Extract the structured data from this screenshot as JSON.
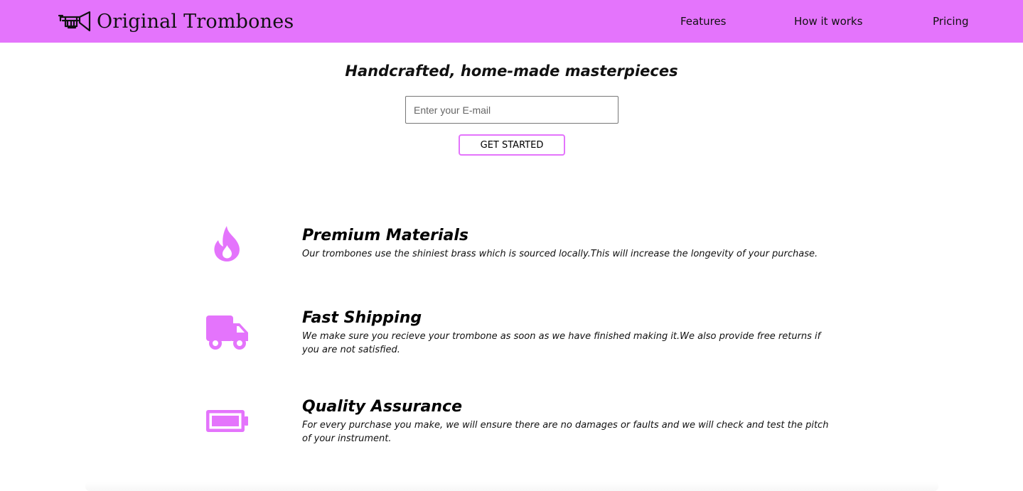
{
  "header": {
    "brand": "Original Trombones",
    "logo_icon": "trombone-icon",
    "nav": [
      {
        "label": "Features"
      },
      {
        "label": "How it works"
      },
      {
        "label": "Pricing"
      }
    ]
  },
  "hero": {
    "title": "Handcrafted, home-made masterpieces",
    "email_placeholder": "Enter your E-mail",
    "email_value": "",
    "cta_label": "GET STARTED"
  },
  "features": [
    {
      "icon": "fire-icon",
      "title": "Premium Materials",
      "description": "Our trombones use the shiniest brass which is sourced locally.This will increase the longevity of your purchase."
    },
    {
      "icon": "truck-icon",
      "title": "Fast Shipping",
      "description": "We make sure you recieve your trombone as soon as we have finished making it.We also provide free returns if you are not satisfied."
    },
    {
      "icon": "battery-full-icon",
      "title": "Quality Assurance",
      "description": "For every purchase you make, we will ensure there are no damages or faults and we will check and test the pitch of your instrument."
    }
  ],
  "colors": {
    "accent": "#e474fc",
    "text": "#000000",
    "background": "#ffffff"
  }
}
